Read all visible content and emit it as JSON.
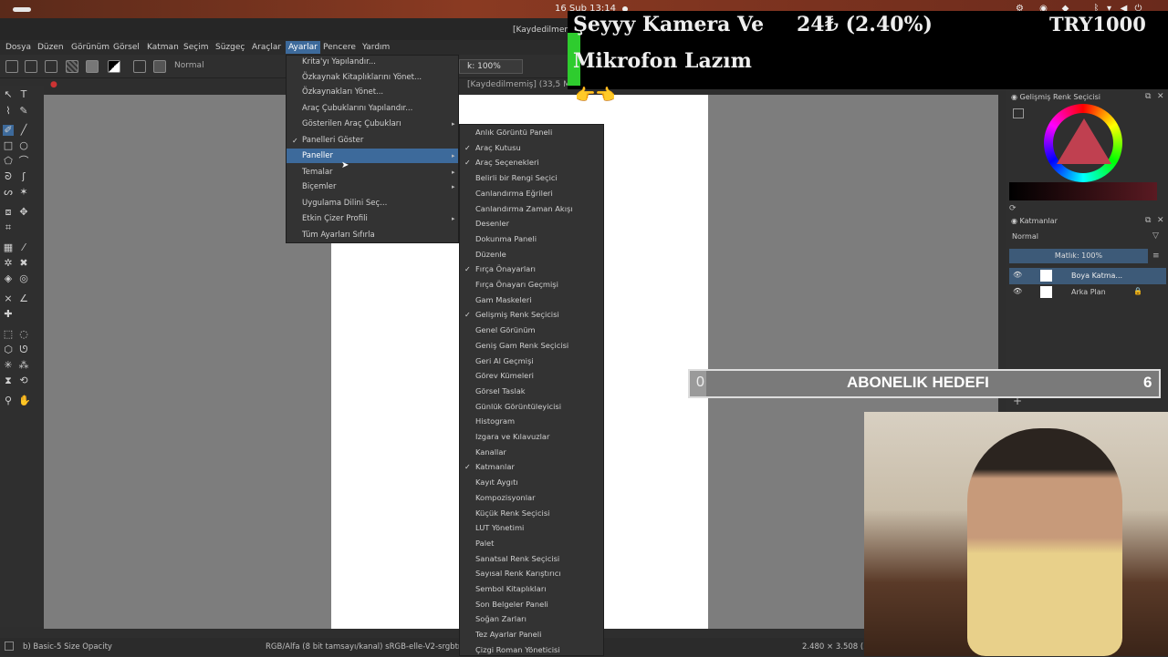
{
  "system": {
    "clock": "16 Şub  13:14"
  },
  "window": {
    "title": "[Kaydedilmemiş] (33,5 MiB) — Krita",
    "doc_tab": "[Kaydedilmemiş]  (33,5 MiB)"
  },
  "menubar": [
    "Dosya",
    "Düzen",
    "Görünüm",
    "Görsel",
    "Katman",
    "Seçim",
    "Süzgeç",
    "Araçlar",
    "Ayarlar",
    "Pencere",
    "Yardım"
  ],
  "toolbar": {
    "blend_mode": "Normal",
    "opacity": "k: 100%"
  },
  "settings_menu": {
    "items": [
      {
        "label": "Krita'yı Yapılandır...",
        "check": false,
        "submenu": false
      },
      {
        "label": "Özkaynak Kitaplıklarını Yönet...",
        "check": false,
        "submenu": false
      },
      {
        "label": "Özkaynakları Yönet...",
        "check": false,
        "submenu": false
      },
      {
        "label": "Araç Çubuklarını Yapılandır...",
        "check": false,
        "submenu": false
      },
      {
        "label": "Gösterilen Araç Çubukları",
        "check": false,
        "submenu": true
      },
      {
        "label": "Panelleri Göster",
        "check": true,
        "submenu": false
      },
      {
        "label": "Paneller",
        "check": false,
        "submenu": true
      },
      {
        "label": "Temalar",
        "check": false,
        "submenu": true
      },
      {
        "label": "Biçemler",
        "check": false,
        "submenu": true
      },
      {
        "label": "Uygulama Dilini Seç...",
        "check": false,
        "submenu": false
      },
      {
        "label": "Etkin Çizer Profili",
        "check": false,
        "submenu": true
      },
      {
        "label": "Tüm Ayarları Sıfırla",
        "check": false,
        "submenu": false
      }
    ]
  },
  "panels_menu": {
    "items": [
      {
        "label": "Anlık Görüntü Paneli",
        "check": false
      },
      {
        "label": "Araç Kutusu",
        "check": true
      },
      {
        "label": "Araç Seçenekleri",
        "check": true
      },
      {
        "label": "Belirli bir Rengi Seçici",
        "check": false
      },
      {
        "label": "Canlandırma Eğrileri",
        "check": false
      },
      {
        "label": "Canlandırma Zaman Akışı",
        "check": false
      },
      {
        "label": "Desenler",
        "check": false
      },
      {
        "label": "Dokunma Paneli",
        "check": false
      },
      {
        "label": "Düzenle",
        "check": false
      },
      {
        "label": "Fırça Önayarları",
        "check": true
      },
      {
        "label": "Fırça Önayarı Geçmişi",
        "check": false
      },
      {
        "label": "Gam Maskeleri",
        "check": false
      },
      {
        "label": "Gelişmiş Renk Seçicisi",
        "check": true
      },
      {
        "label": "Genel Görünüm",
        "check": false
      },
      {
        "label": "Geniş Gam Renk Seçicisi",
        "check": false
      },
      {
        "label": "Geri Al Geçmişi",
        "check": false
      },
      {
        "label": "Görev Kümeleri",
        "check": false
      },
      {
        "label": "Görsel Taslak",
        "check": false
      },
      {
        "label": "Günlük Görüntüleyicisi",
        "check": false
      },
      {
        "label": "Histogram",
        "check": false
      },
      {
        "label": "Izgara ve Kılavuzlar",
        "check": false
      },
      {
        "label": "Kanallar",
        "check": false
      },
      {
        "label": "Katmanlar",
        "check": true
      },
      {
        "label": "Kayıt Aygıtı",
        "check": false
      },
      {
        "label": "Kompozisyonlar",
        "check": false
      },
      {
        "label": "Küçük Renk Seçicisi",
        "check": false
      },
      {
        "label": "LUT Yönetimi",
        "check": false
      },
      {
        "label": "Palet",
        "check": false
      },
      {
        "label": "Sanatsal Renk Seçicisi",
        "check": false
      },
      {
        "label": "Sayısal Renk Karıştırıcı",
        "check": false
      },
      {
        "label": "Sembol Kitaplıkları",
        "check": false
      },
      {
        "label": "Son Belgeler Paneli",
        "check": false
      },
      {
        "label": "Soğan Zarları",
        "check": false
      },
      {
        "label": "Tez Ayarlar Paneli",
        "check": false
      },
      {
        "label": "Çizgi Roman Yöneticisi",
        "check": false
      }
    ]
  },
  "dock": {
    "color_selector_title": "Gelişmiş Renk Seçicisi",
    "layers_title": "Katmanlar",
    "layer_mode": "Normal",
    "layer_opacity": "Matlık:  100%",
    "layers": [
      "Boya Katma...",
      "Arka Plan"
    ]
  },
  "status": {
    "brush": "b) Basic-5 Size Opacity",
    "color_space": "RGB/Alfa (8 bit tamsayı/kanal)  sRGB-elle-V2-srgbtrc",
    "size": "2.480 × 3.508 (3"
  },
  "overlay": {
    "line1": "Şeyyy Kamera Ve",
    "line2": "Mikrofon Lazım",
    "mid": "24₺ (2.40%)",
    "right": "TRY1000",
    "hands": "👉👈",
    "goal_min": "0",
    "goal_label": "ABONELIK HEDEFI",
    "goal_max": "6"
  }
}
